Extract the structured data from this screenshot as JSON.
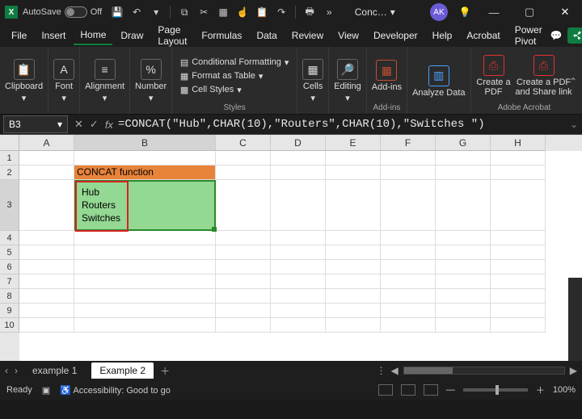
{
  "titlebar": {
    "autosave_label": "AutoSave",
    "autosave_state": "Off",
    "doc_title": "Conc…",
    "avatar_initials": "AK"
  },
  "menu": {
    "items": [
      "File",
      "Insert",
      "Home",
      "Draw",
      "Page Layout",
      "Formulas",
      "Data",
      "Review",
      "View",
      "Developer",
      "Help",
      "Acrobat",
      "Power Pivot"
    ],
    "active_index": 2
  },
  "ribbon": {
    "clipboard": "Clipboard",
    "font": "Font",
    "alignment": "Alignment",
    "number": "Number",
    "styles": "Styles",
    "cond_fmt": "Conditional Formatting",
    "fmt_table": "Format as Table",
    "cell_styles": "Cell Styles",
    "cells": "Cells",
    "editing": "Editing",
    "addins": "Add-ins",
    "analyze": "Analyze Data",
    "create_pdf": "Create a PDF",
    "create_share": "Create a PDF and Share link",
    "addins_label": "Add-ins",
    "acrobat_label": "Adobe Acrobat"
  },
  "formula_bar": {
    "name_box": "B3",
    "formula": "=CONCAT(\"Hub\",CHAR(10),\"Routers\",CHAR(10),\"Switches \")"
  },
  "grid": {
    "columns": [
      "A",
      "B",
      "C",
      "D",
      "E",
      "F",
      "G",
      "H"
    ],
    "rows": [
      "1",
      "2",
      "3",
      "4",
      "5",
      "6",
      "7",
      "8",
      "9",
      "10"
    ],
    "b2_value": "CONCAT function",
    "b3_lines": [
      "Hub",
      "Routers",
      "Switches"
    ]
  },
  "tabs": {
    "items": [
      "example 1",
      "Example 2"
    ],
    "active_index": 1
  },
  "status": {
    "ready": "Ready",
    "accessibility": "Accessibility: Good to go",
    "zoom": "100%"
  }
}
